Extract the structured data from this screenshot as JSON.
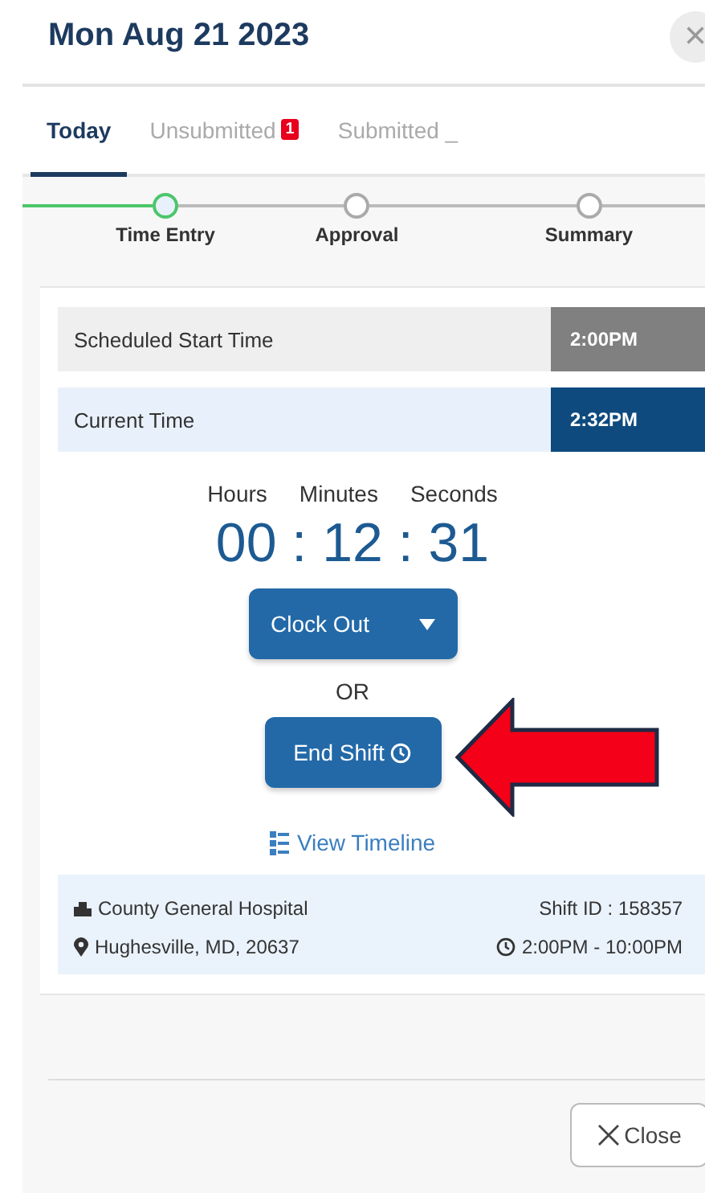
{
  "header": {
    "title": "Mon Aug 21 2023",
    "close_icon": "×"
  },
  "tabs": [
    {
      "label": "Today",
      "selected": true
    },
    {
      "label": "Unsubmitted",
      "badge": "1",
      "selected": false
    },
    {
      "label": "Submitted _",
      "selected": false
    }
  ],
  "steps": [
    {
      "label": "Time Entry",
      "selected": true
    },
    {
      "label": "Approval",
      "selected": false
    },
    {
      "label": "Summary",
      "selected": false
    }
  ],
  "time_rows": [
    {
      "label": "Scheduled Start Time",
      "value": "2:00PM",
      "kind": "scheduled"
    },
    {
      "label": "Current Time",
      "value": "2:32PM",
      "kind": "current"
    }
  ],
  "timer": {
    "units": [
      "Hours",
      "Minutes",
      "Seconds"
    ],
    "reading": "00 : 12 : 31"
  },
  "clock_out_button": "Clock Out",
  "or_text": "OR",
  "end_shift_button": "End Shift",
  "view_timeline_link": "View Timeline",
  "shift": {
    "facility": "County General Hospital",
    "location": "Hughesville, MD, 20637",
    "shift_id": "Shift ID : 158357",
    "hours": "2:00PM - 10:00PM"
  },
  "close_button": "Close"
}
